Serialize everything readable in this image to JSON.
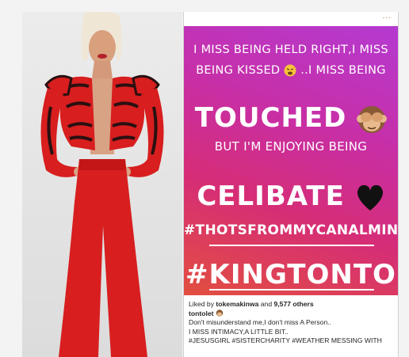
{
  "post": {
    "top_right": "...",
    "graphic_lines": {
      "line1": "I MISS BEING HELD RIGHT,I MISS",
      "line2": "BEING KISSED",
      "line2b": "..I MISS BEING",
      "line3": "TOUCHED",
      "line4": "BUT I'M ENJOYING BEING",
      "line5": "CELIBATE",
      "line6": "#THOTSFROMMYCANALMIND",
      "line7": "#KINGTONTO"
    },
    "emoji": {
      "weary": "weary-face",
      "monkey": "see-no-evil-monkey",
      "heart": "black-heart"
    },
    "likes": {
      "prefix": "Liked by",
      "user": "tokemakinwa",
      "middle": "and",
      "count": "9,577 others"
    },
    "caption": {
      "username": "tontolet",
      "line1": "Don't misunderstand me,I don't miss A Person..",
      "line2": "I MISS INTIMACY,A LITTLE BIT..",
      "hashtags": "#JESUSGIRL #SISTERCHARITY #WEATHER MESSING WITH"
    },
    "colors": {
      "gradient_top": "#b43ad1",
      "gradient_bottom": "#e24f3f",
      "dress": "#d81e1e",
      "background": "#f3f3f3"
    }
  }
}
